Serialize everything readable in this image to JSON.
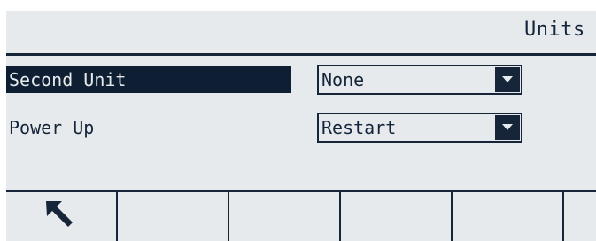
{
  "header": {
    "title": "Units"
  },
  "settings": {
    "second_unit": {
      "label": "Second Unit",
      "value": "None"
    },
    "power_up": {
      "label": "Power Up",
      "value": "Restart"
    }
  },
  "softkeys": [
    {
      "icon": "back-arrow-icon"
    },
    {
      "icon": ""
    },
    {
      "icon": ""
    },
    {
      "icon": ""
    },
    {
      "icon": ""
    },
    {
      "icon": ""
    }
  ],
  "colors": {
    "background": "#e6eaec",
    "foreground": "#14243a",
    "highlight": "#0f1f33"
  }
}
